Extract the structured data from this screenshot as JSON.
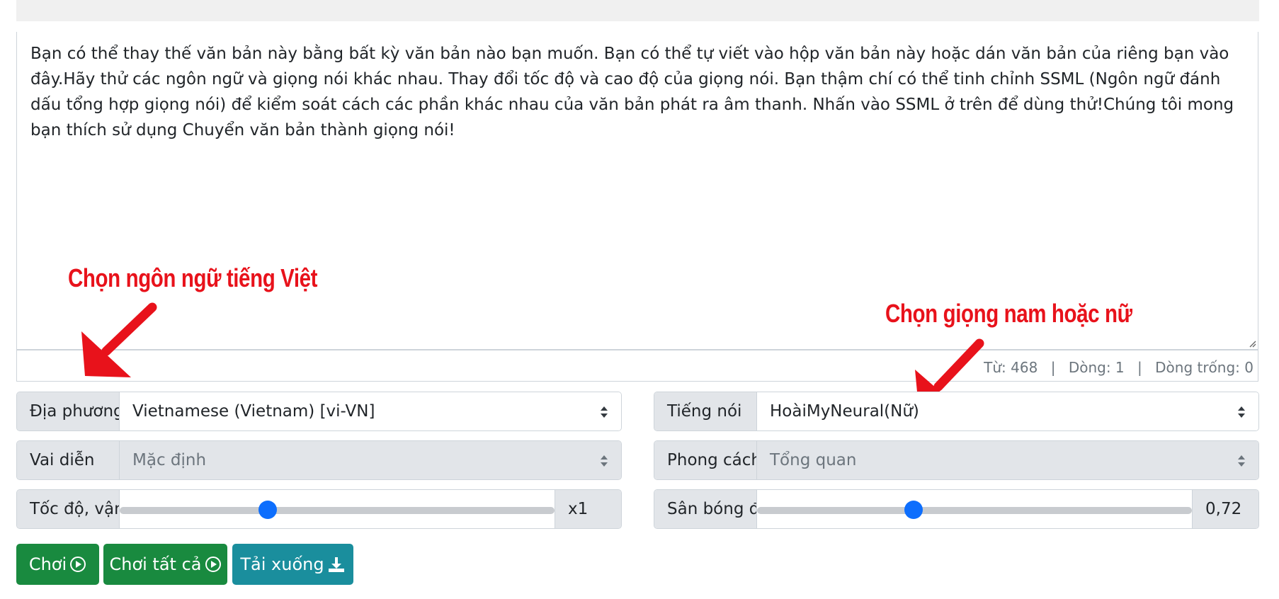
{
  "editor": {
    "text": "Bạn có thể thay thế văn bản này bằng bất kỳ văn bản nào bạn muốn. Bạn có thể tự viết vào hộp văn bản này hoặc dán văn bản của riêng bạn vào đây.Hãy thử các ngôn ngữ và giọng nói khác nhau. Thay đổi tốc độ và cao độ của giọng nói. Bạn thậm chí có thể tinh chỉnh SSML (Ngôn ngữ đánh dấu tổng hợp giọng nói) để kiểm soát cách các phần khác nhau của văn bản phát ra âm thanh. Nhấn vào SSML ở trên để dùng thử!Chúng tôi mong bạn thích sử dụng Chuyển văn bản thành giọng nói!"
  },
  "counts": {
    "words_label": "Từ:",
    "words_value": "468",
    "lines_label": "Dòng:",
    "lines_value": "1",
    "empty_lines_label": "Dòng trống:",
    "empty_lines_value": "0",
    "separator": "|"
  },
  "annotations": {
    "left": "Chọn ngôn ngữ tiếng Việt",
    "right": "Chọn giọng nam hoặc nữ",
    "color": "#e8121b"
  },
  "controls": {
    "locale": {
      "label": "Địa phương",
      "value": "Vietnamese (Vietnam) [vi-VN]"
    },
    "voice": {
      "label": "Tiếng nói",
      "value": "HoàiMyNeural(Nữ)"
    },
    "role": {
      "label": "Vai diễn",
      "value": "Mặc định"
    },
    "style": {
      "label": "Phong cách",
      "value": "Tổng quan"
    },
    "speed": {
      "label": "Tốc độ, vận tốc",
      "value": "x1",
      "level": 0.34
    },
    "pitch": {
      "label": "Sân bóng đá",
      "value": "0,72",
      "level": 0.36
    }
  },
  "buttons": {
    "play": "Chơi",
    "play_all": "Chơi tất cả",
    "download": "Tải xuống"
  },
  "colors": {
    "accent": "#0d6efd",
    "play_button": "#198a3f",
    "download_button": "#1a8e9d"
  },
  "icons": {
    "play": "play-circle-icon",
    "download": "download-icon",
    "caret": "select-caret-icon"
  }
}
